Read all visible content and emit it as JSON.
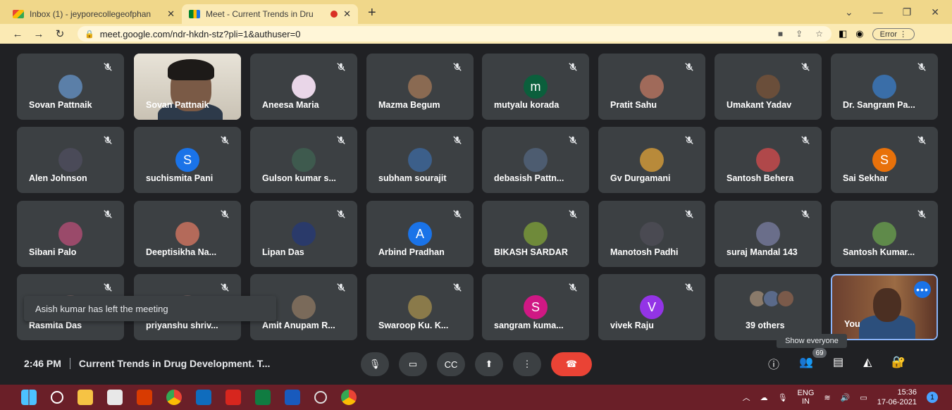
{
  "browser": {
    "tabs": [
      {
        "title": "Inbox (1) - jeyporecollegeofphan",
        "favicon": "gmail-icon",
        "active": false
      },
      {
        "title": "Meet - Current Trends in Dru",
        "favicon": "meet-icon",
        "active": true
      }
    ],
    "new_tab": "+",
    "url": "meet.google.com/ndr-hkdn-stz?pli=1&authuser=0",
    "error_label": "Error"
  },
  "participants": [
    {
      "name": "Sovan Pattnaik",
      "avatar": "photo",
      "color": "#5b7fa8"
    },
    {
      "name": "Sovan Pattnaik",
      "avatar": "video"
    },
    {
      "name": "Aneesa Maria",
      "avatar": "photo",
      "color": "#e9d6e8"
    },
    {
      "name": "Mazma Begum",
      "avatar": "photo",
      "color": "#8a6a52"
    },
    {
      "name": "mutyalu korada",
      "avatar": "m",
      "color": "#0b5f3c"
    },
    {
      "name": "Pratit Sahu",
      "avatar": "photo",
      "color": "#a06a5a"
    },
    {
      "name": "Umakant Yadav",
      "avatar": "photo",
      "color": "#6a4e3a"
    },
    {
      "name": "Dr. Sangram Pa...",
      "avatar": "photo",
      "color": "#3a6ea8"
    },
    {
      "name": "Alen Johnson",
      "avatar": "photo",
      "color": "#4a4a58"
    },
    {
      "name": "suchismita Pani",
      "avatar": "S",
      "color": "#1a73e8"
    },
    {
      "name": "Gulson kumar s...",
      "avatar": "photo",
      "color": "#3e5a4e"
    },
    {
      "name": "subham sourajit",
      "avatar": "photo",
      "color": "#3c5f8a"
    },
    {
      "name": "debasish Pattn...",
      "avatar": "photo",
      "color": "#4d5c70"
    },
    {
      "name": "Gv Durgamani",
      "avatar": "photo",
      "color": "#b88a3a"
    },
    {
      "name": "Santosh Behera",
      "avatar": "photo",
      "color": "#b0484a"
    },
    {
      "name": "Sai Sekhar",
      "avatar": "S",
      "color": "#e8710a"
    },
    {
      "name": "Sibani Palo",
      "avatar": "photo",
      "color": "#9a4a6a"
    },
    {
      "name": "Deeptisikha Na...",
      "avatar": "photo",
      "color": "#b46a5a"
    },
    {
      "name": "Lipan Das",
      "avatar": "photo",
      "color": "#2a3a6a"
    },
    {
      "name": "Arbind Pradhan",
      "avatar": "A",
      "color": "#1a73e8"
    },
    {
      "name": "BIKASH SARDAR",
      "avatar": "photo",
      "color": "#6f8a3a"
    },
    {
      "name": "Manotosh Padhi",
      "avatar": "photo",
      "color": "#4a4a52"
    },
    {
      "name": "suraj Mandal 143",
      "avatar": "photo",
      "color": "#6a6e8a"
    },
    {
      "name": "Santosh Kumar...",
      "avatar": "photo",
      "color": "#5f8a4a"
    },
    {
      "name": "Rasmita Das",
      "avatar": "photo",
      "color": "#6a5a5a"
    },
    {
      "name": "priyanshu shriv...",
      "avatar": "photo",
      "color": "#6a5a5a"
    },
    {
      "name": "Amit Anupam R...",
      "avatar": "photo",
      "color": "#7a6a5a"
    },
    {
      "name": "Swaroop Ku. K...",
      "avatar": "photo",
      "color": "#8a7a4a"
    },
    {
      "name": "sangram kuma...",
      "avatar": "S",
      "color": "#d01884"
    },
    {
      "name": "vivek Raju",
      "avatar": "V",
      "color": "#9334e6"
    },
    {
      "name": "39 others",
      "avatar": "others"
    },
    {
      "name": "You",
      "avatar": "you"
    }
  ],
  "toast": "Asish kumar has left the meeting",
  "tooltip": "Show everyone",
  "people_count": "69",
  "meeting": {
    "time": "2:46 PM",
    "title": "Current Trends in Drug Development. T..."
  },
  "taskbar": {
    "lang_top": "ENG",
    "lang_bottom": "IN",
    "time": "15:36",
    "date": "17-06-2021",
    "notif": "1"
  }
}
